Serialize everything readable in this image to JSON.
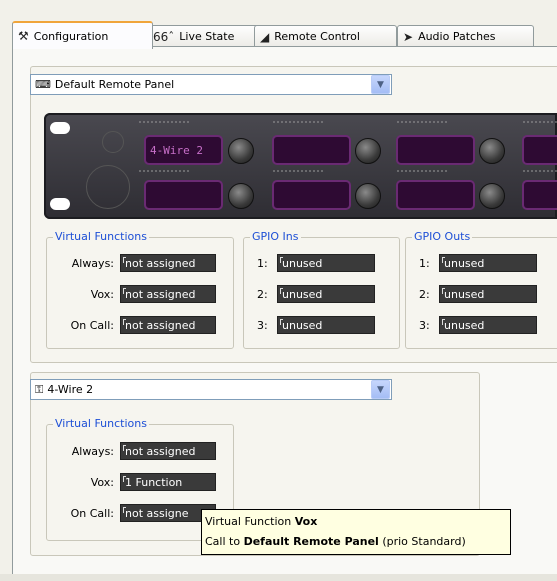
{
  "tabs": [
    {
      "label": "Configuration",
      "icon": "wrench-hammer-icon",
      "active": true
    },
    {
      "label": "Live State",
      "icon": "glasses-icon",
      "active": false
    },
    {
      "label": "Remote Control",
      "icon": "remote-control-icon",
      "active": false
    },
    {
      "label": "Audio Patches",
      "icon": "audio-patch-icon",
      "active": false
    }
  ],
  "panel_select": {
    "value": "Default Remote Panel",
    "icon": "keyboard-icon"
  },
  "device": {
    "display_text": "4-Wire 2"
  },
  "virtual_functions": {
    "legend": "Virtual Functions",
    "rows": [
      {
        "label": "Always:",
        "value": "not assigned"
      },
      {
        "label": "Vox:",
        "value": "not assigned"
      },
      {
        "label": "On Call:",
        "value": "not assigned"
      }
    ]
  },
  "gpio_ins": {
    "legend": "GPIO Ins",
    "rows": [
      {
        "label": "1:",
        "value": "unused"
      },
      {
        "label": "2:",
        "value": "unused"
      },
      {
        "label": "3:",
        "value": "unused"
      }
    ]
  },
  "gpio_outs": {
    "legend": "GPIO Outs",
    "rows": [
      {
        "label": "1:",
        "value": "unused"
      },
      {
        "label": "2:",
        "value": "unused"
      },
      {
        "label": "3:",
        "value": "unused"
      }
    ]
  },
  "key_select": {
    "value": "4-Wire 2",
    "icon": "key-icon"
  },
  "key_virtual_functions": {
    "legend": "Virtual Functions",
    "rows": [
      {
        "label": "Always:",
        "value": "not assigned"
      },
      {
        "label": "Vox:",
        "value": "1 Function"
      },
      {
        "label": "On Call:",
        "value": "not assigne"
      }
    ]
  },
  "tooltip": {
    "line1_prefix": "Virtual Function ",
    "line1_bold": "Vox",
    "line2_prefix": "Call to ",
    "line2_bold": "Default Remote Panel",
    "line2_suffix": " (prio Standard)"
  }
}
